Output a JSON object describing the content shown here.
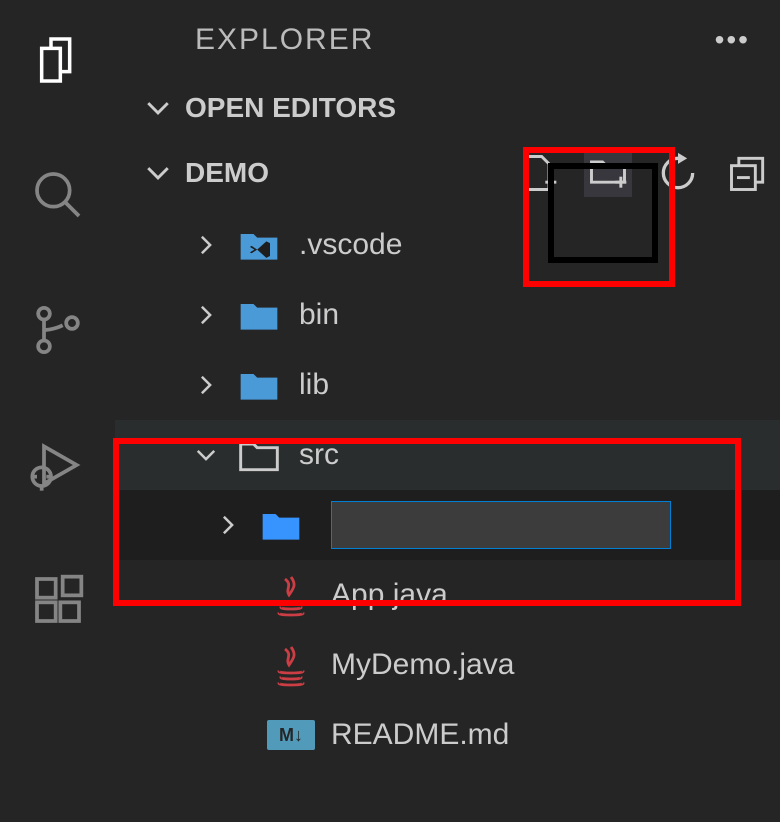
{
  "sidebar": {
    "title": "EXPLORER"
  },
  "sections": {
    "openEditors": "OPEN EDITORS",
    "project": "DEMO"
  },
  "tree": {
    "vscode": ".vscode",
    "bin": "bin",
    "lib": "lib",
    "src": "src",
    "newFolderValue": "",
    "app": "App.java",
    "mydemo": "MyDemo.java",
    "readme": "README.md"
  },
  "readmeBadge": "M↓"
}
